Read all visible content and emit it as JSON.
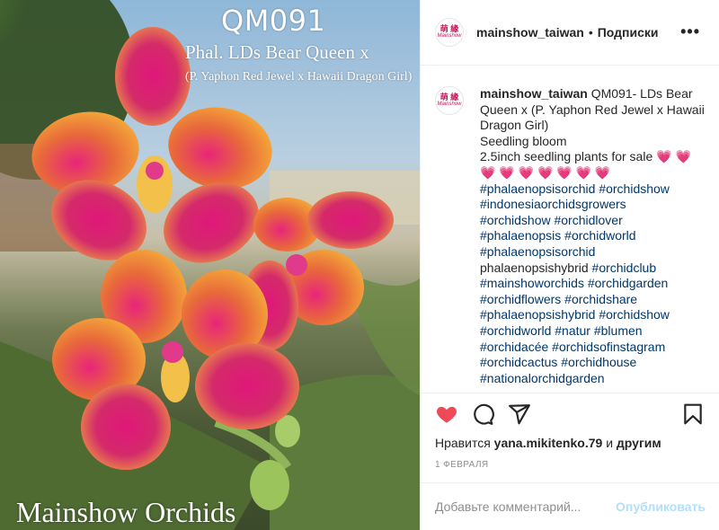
{
  "photo": {
    "watermark_code": "QM091",
    "watermark_line1": "Phal. LDs Bear Queen x",
    "watermark_line2": "(P. Yaphon Red Jewel x Hawaii Dragon Girl)",
    "watermark_brand": "Mainshow Orchids"
  },
  "header": {
    "avatar_text": "萌 緣",
    "avatar_sub": "Mainshow",
    "username": "mainshow_taiwan",
    "separator": "•",
    "follow_label": "Подписки",
    "more_icon": "more-horizontal-icon",
    "more_glyph": "•••"
  },
  "caption": {
    "username": "mainshow_taiwan",
    "text": "QM091- LDs Bear Queen x (P. Yaphon Red Jewel x Hawaii Dragon Girl)",
    "line2": "Seedling bloom",
    "line3": "2.5inch seedling plants for sale",
    "hearts_inline": "💗 💗",
    "hearts_row": "💗 💗 💗 💗 💗 💗 💗",
    "tags": [
      "#phalaenopsisorchid #orchidshow",
      "#indonesiaorchidsgrowers",
      "#orchidshow #orchidlover",
      "#phalaenopsis #orchidworld",
      "#phalaenopsisorchid"
    ],
    "plain_line": "phalaenopsishybrid",
    "plain_tag": "#orchidclub",
    "tags2": [
      "#mainshoworchids #orchidgarden",
      "#orchidflowers #orchidshare",
      "#phalaenopsishybrid #orchidshow",
      "#orchidworld #natur #blumen",
      "#orchidacée #orchidsofinstagram",
      "#orchidcactus #orchidhouse",
      "#nationalorchidgarden"
    ]
  },
  "actions": {
    "like_icon": "heart-filled-icon",
    "comment_icon": "comment-icon",
    "share_icon": "share-icon",
    "save_icon": "bookmark-icon",
    "like_color": "#ed4956"
  },
  "likes": {
    "prefix": "Нравится",
    "user": "yana.mikitenko.79",
    "suffix_and": "и",
    "others": "другим"
  },
  "date": "1 ФЕВРАЛЯ",
  "comment": {
    "placeholder": "Добавьте комментарий...",
    "post_label": "Опубликовать"
  }
}
